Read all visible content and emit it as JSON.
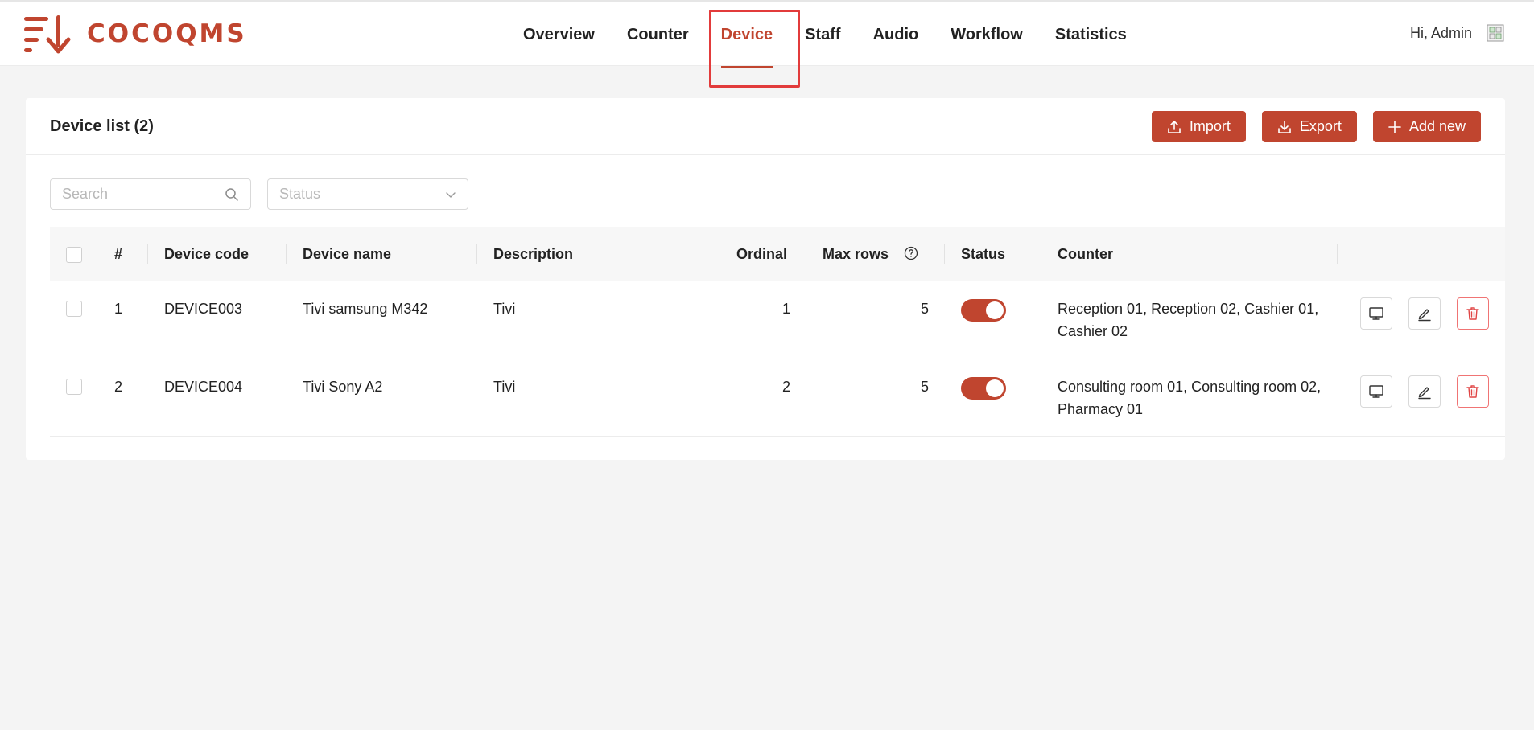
{
  "brand": {
    "name": "COCOQMS",
    "color": "#c0452f"
  },
  "nav": {
    "items": [
      {
        "label": "Overview"
      },
      {
        "label": "Counter"
      },
      {
        "label": "Device",
        "active": true
      },
      {
        "label": "Staff"
      },
      {
        "label": "Audio"
      },
      {
        "label": "Workflow"
      },
      {
        "label": "Statistics"
      }
    ]
  },
  "user": {
    "greeting": "Hi, Admin",
    "avatar_icon": "avatar-icon"
  },
  "card": {
    "title": "Device list (2)",
    "actions": {
      "import_label": "Import",
      "export_label": "Export",
      "add_label": "Add new"
    }
  },
  "filters": {
    "search_placeholder": "Search",
    "status_placeholder": "Status"
  },
  "table": {
    "columns": {
      "index": "#",
      "code": "Device code",
      "name": "Device name",
      "description": "Description",
      "ordinal": "Ordinal",
      "max_rows": "Max rows",
      "status": "Status",
      "counter": "Counter"
    },
    "rows": [
      {
        "index": "1",
        "code": "DEVICE003",
        "name": "Tivi samsung M342",
        "description": "Tivi",
        "ordinal": "1",
        "max_rows": "5",
        "status_on": true,
        "counter": "Reception 01, Reception 02, Cashier 01, Cashier 02"
      },
      {
        "index": "2",
        "code": "DEVICE004",
        "name": "Tivi Sony A2",
        "description": "Tivi",
        "ordinal": "2",
        "max_rows": "5",
        "status_on": true,
        "counter": "Consulting room 01, Consulting room 02, Pharmacy 01"
      }
    ]
  }
}
